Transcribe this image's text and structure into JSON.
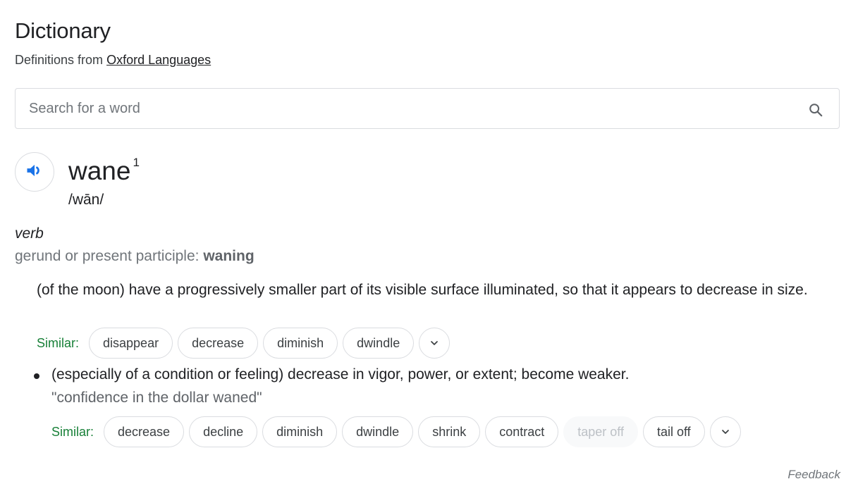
{
  "header": {
    "title": "Dictionary",
    "source_prefix": "Definitions from",
    "source_link": "Oxford Languages"
  },
  "search": {
    "placeholder": "Search for a word",
    "icon": "search-icon"
  },
  "entry": {
    "speaker_icon": "speaker-icon",
    "word": "wane",
    "superscript": "1",
    "phonetic": "/wān/",
    "part_of_speech": "verb",
    "gerund_label": "gerund or present participle:",
    "gerund_value": "waning",
    "senses": [
      {
        "definition": "(of the moon) have a progressively smaller part of its visible surface illuminated, so that it appears to decrease in size.",
        "similar_label": "Similar:",
        "similar": [
          "disappear",
          "decrease",
          "diminish",
          "dwindle"
        ]
      },
      {
        "definition": "(especially of a condition or feeling) decrease in vigor, power, or extent; become weaker.",
        "example": "\"confidence in the dollar waned\"",
        "similar_label": "Similar:",
        "similar": [
          "decrease",
          "decline",
          "diminish",
          "dwindle",
          "shrink",
          "contract",
          "taper off",
          "tail off"
        ],
        "disabled": [
          "taper off"
        ]
      }
    ]
  },
  "footer": {
    "feedback": "Feedback"
  },
  "colors": {
    "similar_label": "#188038",
    "speaker_blue": "#1a73e8",
    "border": "#dadce0"
  }
}
